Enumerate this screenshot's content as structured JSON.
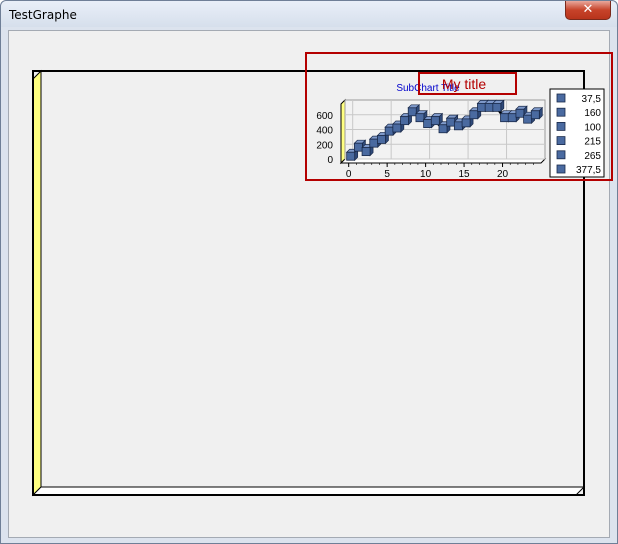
{
  "window": {
    "title": "TestGraphe",
    "close_glyph": "✕"
  },
  "main_chart": {
    "title": "My title",
    "wall_color": "#ffff80",
    "border_color": "#000000",
    "annotation_color": "#b40000"
  },
  "chart_data": {
    "type": "line",
    "title": "SubChart Title",
    "xlabel": "",
    "ylabel": "",
    "ylim": [
      0,
      800
    ],
    "xlim": [
      -1,
      25
    ],
    "x_ticks": [
      0,
      5,
      10,
      15,
      20
    ],
    "y_ticks": [
      0,
      200,
      400,
      600
    ],
    "grid": true,
    "marker_color": "#4a6aa0",
    "series": [
      {
        "x": [
          0,
          1,
          2,
          3,
          4,
          5,
          6,
          7,
          8,
          9,
          10,
          11,
          12,
          13,
          14,
          15,
          16,
          17,
          18,
          19,
          20,
          21,
          22,
          23,
          24
        ],
        "values": [
          37.5,
          160,
          100,
          215,
          265,
          377.5,
          420,
          520,
          640,
          560,
          480,
          520,
          410,
          500,
          450,
          490,
          600,
          700,
          700,
          700,
          560,
          560,
          620,
          540,
          600
        ]
      }
    ],
    "legend": {
      "position": "right",
      "entries": [
        "37,5",
        "160",
        "100",
        "215",
        "265",
        "377,5"
      ]
    }
  }
}
